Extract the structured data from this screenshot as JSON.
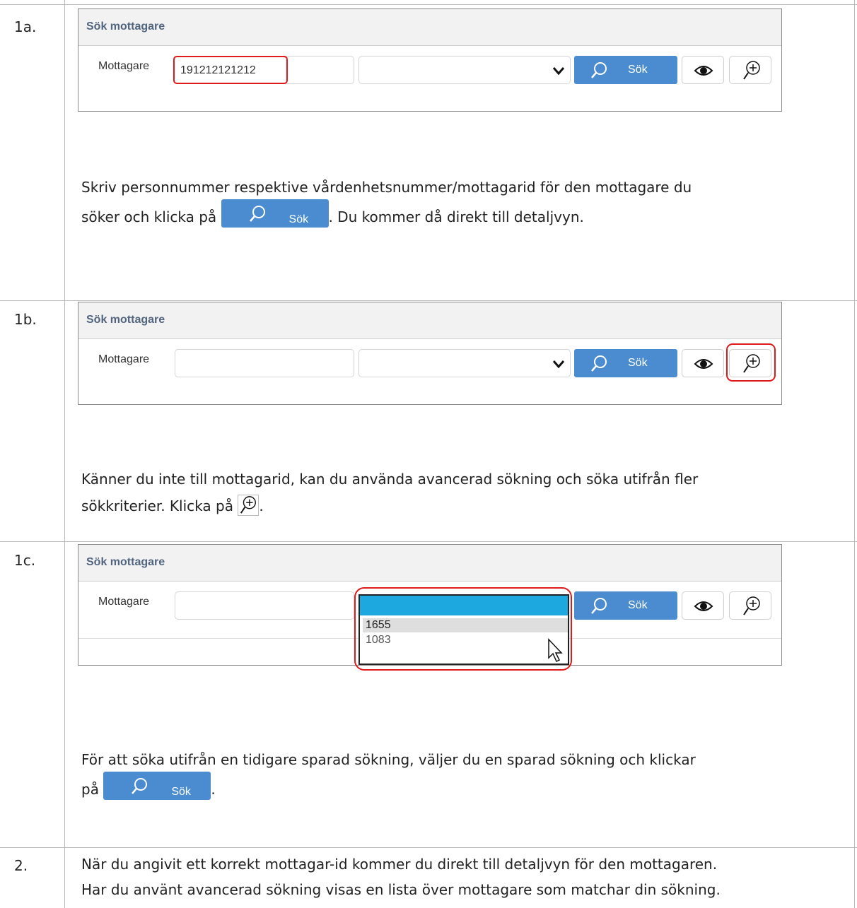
{
  "steps": {
    "s1a": {
      "num": "1a.",
      "panel_title": "Sök mottagare",
      "field_label": "Mottagare",
      "field_value": "191212121212",
      "search_label": "Sök",
      "text_line1": "Skriv personnummer respektive vårdenhetsnummer/mottagarid för den mottagare du",
      "text_line2_before": "söker och klicka på",
      "inline_button": "Sök",
      "text_line2_after": ". Du kommer då direkt till detaljvyn."
    },
    "s1b": {
      "num": "1b.",
      "panel_title": "Sök mottagare",
      "field_label": "Mottagare",
      "field_value": "",
      "search_label": "Sök",
      "text_line1": "Känner du inte till mottagarid, kan du använda avancerad sökning och söka utifrån fler",
      "text_line2_before": "sökkriterier. Klicka på",
      "text_line2_after": "."
    },
    "s1c": {
      "num": "1c.",
      "panel_title": "Sök mottagare",
      "field_label": "Mottagare",
      "search_label": "Sök",
      "dropdown_options": [
        "1655",
        "1083"
      ],
      "text_line1": "För att söka utifrån en tidigare sparad sökning, väljer du en sparad sökning och klickar",
      "text_line2_before": "på",
      "inline_button": "Sök",
      "text_line2_after": "."
    },
    "s2": {
      "num": "2.",
      "text_line1": "När du angivit ett korrekt mottagar-id kommer du direkt till detaljvyn för den mottagaren.",
      "text_line2": "Har du använt avancerad sökning visas en lista över mottagare som matchar din sökning."
    }
  },
  "colors": {
    "button_blue": "#4a8ccf",
    "highlight_red": "#e01a1a",
    "dropdown_selected": "#1ea8e0",
    "panel_title": "#51657f"
  },
  "icons": [
    "search-icon",
    "eye-icon",
    "zoom-plus-icon",
    "chevron-down-icon",
    "mouse-cursor-icon"
  ]
}
